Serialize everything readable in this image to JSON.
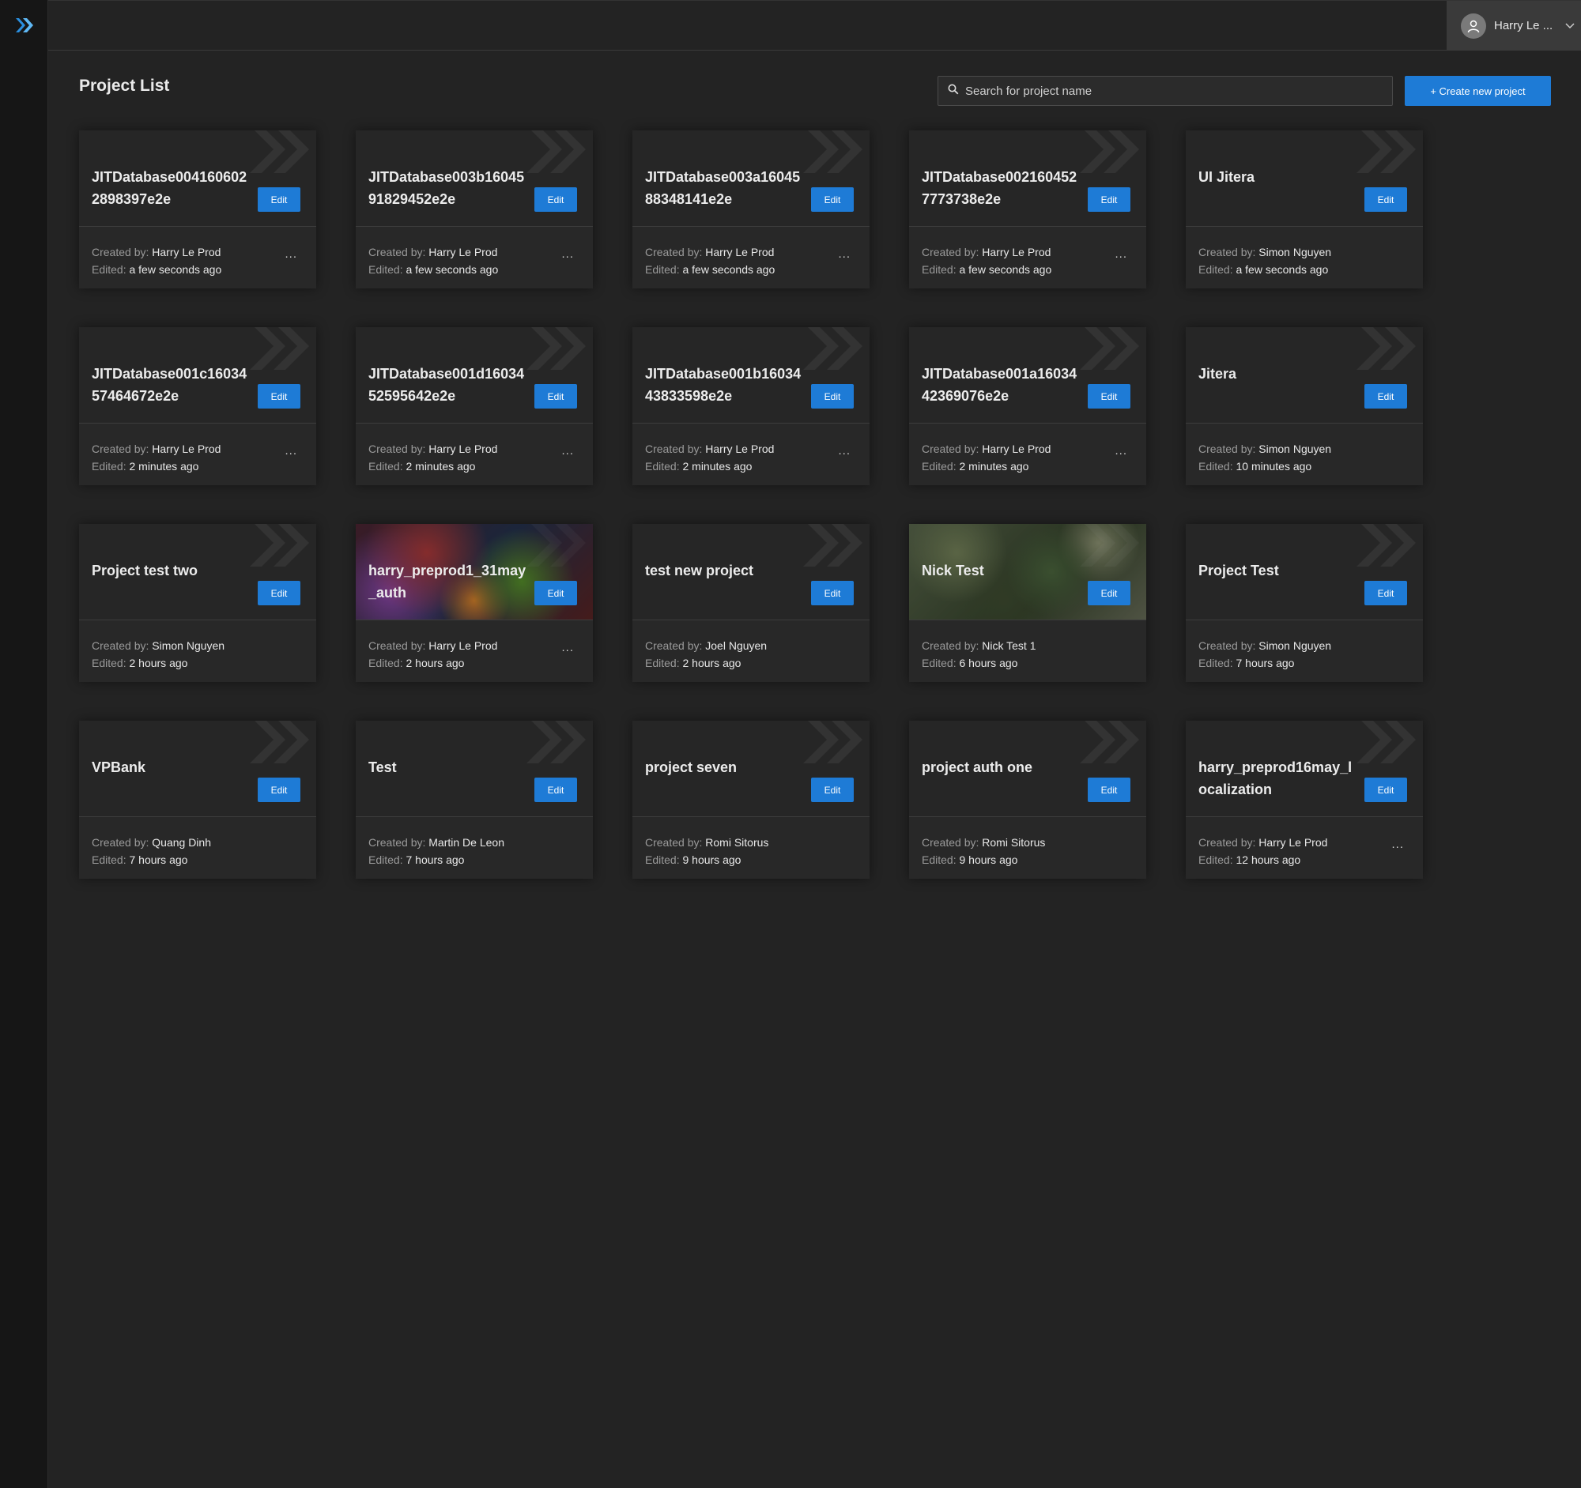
{
  "header": {
    "user_name": "Harry Le ..."
  },
  "page": {
    "title": "Project List",
    "search_placeholder": "Search for project name",
    "create_label": "+ Create new project"
  },
  "labels": {
    "created_by": "Created by:",
    "edited": "Edited:",
    "edit": "Edit",
    "more": "..."
  },
  "projects": [
    {
      "name": "JITDatabase0041606022898397e2e",
      "creator": "Harry Le Prod",
      "edited": "a few seconds ago",
      "has_more": true,
      "bg": ""
    },
    {
      "name": "JITDatabase003b1604591829452e2e",
      "creator": "Harry Le Prod",
      "edited": "a few seconds ago",
      "has_more": true,
      "bg": ""
    },
    {
      "name": "JITDatabase003a1604588348141e2e",
      "creator": "Harry Le Prod",
      "edited": "a few seconds ago",
      "has_more": true,
      "bg": ""
    },
    {
      "name": "JITDatabase0021604527773738e2e",
      "creator": "Harry Le Prod",
      "edited": "a few seconds ago",
      "has_more": true,
      "bg": ""
    },
    {
      "name": "UI Jitera",
      "creator": "Simon Nguyen",
      "edited": "a few seconds ago",
      "has_more": false,
      "bg": ""
    },
    {
      "name": "JITDatabase001c1603457464672e2e",
      "creator": "Harry Le Prod",
      "edited": "2 minutes ago",
      "has_more": true,
      "bg": ""
    },
    {
      "name": "JITDatabase001d1603452595642e2e",
      "creator": "Harry Le Prod",
      "edited": "2 minutes ago",
      "has_more": true,
      "bg": ""
    },
    {
      "name": "JITDatabase001b1603443833598e2e",
      "creator": "Harry Le Prod",
      "edited": "2 minutes ago",
      "has_more": true,
      "bg": ""
    },
    {
      "name": "JITDatabase001a1603442369076e2e",
      "creator": "Harry Le Prod",
      "edited": "2 minutes ago",
      "has_more": true,
      "bg": ""
    },
    {
      "name": "Jitera",
      "creator": "Simon Nguyen",
      "edited": "10 minutes ago",
      "has_more": false,
      "bg": ""
    },
    {
      "name": "Project test two",
      "creator": "Simon Nguyen",
      "edited": "2 hours ago",
      "has_more": false,
      "bg": ""
    },
    {
      "name": "harry_preprod1_31may_auth",
      "creator": "Harry Le Prod",
      "edited": "2 hours ago",
      "has_more": true,
      "bg": "anime"
    },
    {
      "name": "test new project",
      "creator": "Joel Nguyen",
      "edited": "2 hours ago",
      "has_more": false,
      "bg": ""
    },
    {
      "name": "Nick Test",
      "creator": "Nick Test 1",
      "edited": "6 hours ago",
      "has_more": false,
      "bg": "tree"
    },
    {
      "name": "Project Test",
      "creator": "Simon Nguyen",
      "edited": "7 hours ago",
      "has_more": false,
      "bg": ""
    },
    {
      "name": "VPBank",
      "creator": "Quang Dinh",
      "edited": "7 hours ago",
      "has_more": false,
      "bg": ""
    },
    {
      "name": "Test",
      "creator": "Martin De Leon",
      "edited": "7 hours ago",
      "has_more": false,
      "bg": ""
    },
    {
      "name": "project seven",
      "creator": "Romi Sitorus",
      "edited": "9 hours ago",
      "has_more": false,
      "bg": ""
    },
    {
      "name": "project auth one",
      "creator": "Romi Sitorus",
      "edited": "9 hours ago",
      "has_more": false,
      "bg": ""
    },
    {
      "name": "harry_preprod16may_localization",
      "creator": "Harry Le Prod",
      "edited": "12 hours ago",
      "has_more": true,
      "bg": ""
    }
  ],
  "colors": {
    "accent": "#1e7bd6",
    "background": "#232323",
    "sidebar": "#161616",
    "card": "#282828"
  },
  "icons": {
    "logo": "jitera-chevron-logo",
    "search": "search-icon",
    "avatar": "user-icon",
    "dropdown": "chevron-down-icon"
  }
}
